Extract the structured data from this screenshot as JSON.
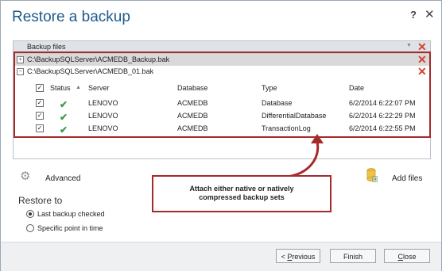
{
  "window": {
    "title": "Restore a backup",
    "help_glyph": "?",
    "close_glyph": "✕"
  },
  "backup_files": {
    "header": "Backup files",
    "files": [
      {
        "toggle": "+",
        "path": "C:\\BackupSQLServer\\ACMEDB_Backup.bak"
      },
      {
        "toggle": "−",
        "path": "C:\\BackupSQLServer\\ACMEDB_01.bak"
      }
    ],
    "columns": [
      "Status",
      "Server",
      "Database",
      "Type",
      "Date"
    ],
    "rows": [
      {
        "server": "LENOVO",
        "database": "ACMEDB",
        "type": "Database",
        "date": "6/2/2014 6:22:07 PM"
      },
      {
        "server": "LENOVO",
        "database": "ACMEDB",
        "type": "DifferentialDatabase",
        "date": "6/2/2014 6:22:29 PM"
      },
      {
        "server": "LENOVO",
        "database": "ACMEDB",
        "type": "TransactionLog",
        "date": "6/2/2014 6:22:55 PM"
      }
    ]
  },
  "actions": {
    "advanced": "Advanced",
    "add_files": "Add files"
  },
  "callout": {
    "line1": "Attach either native or natively",
    "line2": "compressed backup sets"
  },
  "restore_to": {
    "label": "Restore to",
    "options": [
      "Last backup checked",
      "Specific point in time"
    ]
  },
  "buttons": {
    "previous_prefix": "< ",
    "previous_key": "P",
    "previous_rest": "revious",
    "finish": "Finish",
    "close_key": "C",
    "close_rest": "lose"
  },
  "colors": {
    "title": "#1e5a8c",
    "highlight": "#a52a2a",
    "check": "#3c9a49",
    "remove": "#d4432c"
  }
}
